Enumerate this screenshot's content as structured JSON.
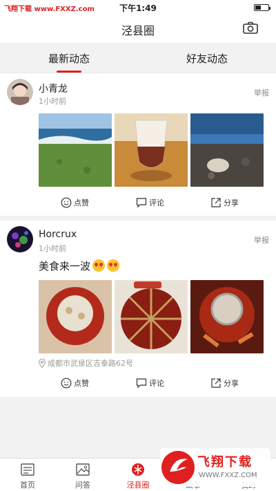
{
  "status_bar": {
    "watermark": "飞翔下载 www.FXXZ.com",
    "time": "下午1:49"
  },
  "nav": {
    "title": "泾县圈",
    "camera_icon": "camera-icon"
  },
  "tabs": [
    {
      "label": "最新动态",
      "active": true
    },
    {
      "label": "好友动态",
      "active": false
    }
  ],
  "colors": {
    "accent": "#e02020",
    "background": "#f2f2f2",
    "card": "#ffffff",
    "muted": "#999999"
  },
  "posts": [
    {
      "user": "小青龙",
      "time": "1小时前",
      "report": "举报",
      "text": "",
      "images": [
        "coast-photo",
        "drink-photo",
        "lakeside-photo"
      ],
      "location": "",
      "actions": {
        "like": "点赞",
        "comment": "评论",
        "share": "分享"
      }
    },
    {
      "user": "Horcrux",
      "time": "1小时前",
      "report": "举报",
      "text": "美食来一波",
      "emojis": 2,
      "images": [
        "hotpot-photo-1",
        "hotpot-photo-2",
        "hotpot-photo-3"
      ],
      "location": "成都市武侯区吉泰路62号",
      "actions": {
        "like": "点赞",
        "comment": "评论",
        "share": "分享"
      }
    }
  ],
  "tabbar": [
    {
      "label": "首页",
      "icon": "home-icon",
      "active": false
    },
    {
      "label": "问答",
      "icon": "qa-icon",
      "active": false
    },
    {
      "label": "泾县圈",
      "icon": "circle-icon",
      "active": true
    },
    {
      "label": "故事",
      "icon": "story-icon",
      "active": false
    },
    {
      "label": "我的",
      "icon": "profile-icon",
      "active": false
    }
  ],
  "brand_watermark": {
    "title": "飞翔下载",
    "url": "WWW.FXXZ.COM"
  }
}
